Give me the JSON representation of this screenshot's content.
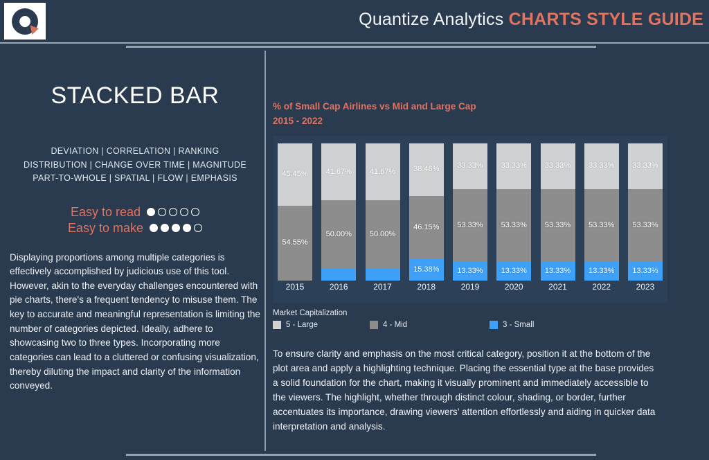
{
  "header": {
    "brand": "Quantize Analytics",
    "guide": "CHARTS STYLE GUIDE",
    "logo_icon": "donut-chart-logo-icon",
    "accent_color": "#e3725f",
    "background_color": "#2a3a4f"
  },
  "left": {
    "chart_type_title": "STACKED BAR",
    "taxonomy": [
      "DEVIATION | CORRELATION | RANKING",
      "DISTRIBUTION | CHANGE OVER TIME | MAGNITUDE",
      "PART-TO-WHOLE | SPATIAL | FLOW | EMPHASIS"
    ],
    "ratings": [
      {
        "label": "Easy to read",
        "filled": 1,
        "total": 5
      },
      {
        "label": "Easy to make",
        "filled": 4,
        "total": 5
      }
    ],
    "body": "Displaying proportions among multiple categories is effectively accomplished by judicious use of this tool. However, akin to the everyday challenges encountered with pie charts, there's a frequent tendency to misuse them. The key to accurate and meaningful representation is limiting the number of categories depicted. Ideally, adhere to showcasing two to three types. Incorporating more categories can lead to a cluttered or confusing visualization, thereby diluting the impact and clarity of the information conveyed."
  },
  "right": {
    "chart_title_line1": "% of Small Cap Airlines vs Mid and Large Cap",
    "chart_title_line2": "2015 - 2022",
    "body": "To ensure clarity and emphasis on the most critical category, position it at the bottom of the plot area and apply a highlighting technique. Placing the essential type at the base provides a solid foundation for the chart, making it visually prominent and immediately accessible to the viewers. The highlight, whether through distinct colour, shading, or border, further accentuates its importance, drawing viewers’ attention effortlessly and aiding in quicker data interpretation and analysis."
  },
  "chart_data": {
    "type": "bar",
    "stacked": true,
    "title": "% of Small Cap Airlines vs Mid and Large Cap 2015 - 2022",
    "xlabel": "",
    "ylabel": "",
    "ylim": [
      0,
      100
    ],
    "grid": false,
    "legend_title": "Market Capitalization",
    "legend_position": "bottom-left",
    "categories": [
      "2015",
      "2016",
      "2017",
      "2018",
      "2019",
      "2020",
      "2021",
      "2022",
      "2023"
    ],
    "series": [
      {
        "name": "5 - Large",
        "color": "#cfd1d2",
        "values": [
          45.45,
          41.67,
          41.67,
          38.46,
          33.33,
          33.33,
          33.33,
          33.33,
          33.33
        ],
        "labels": [
          "45.45%",
          "41.67%",
          "41.67%",
          "38.46%",
          "33.33%",
          "33.33%",
          "33.33%",
          "33.33%",
          "33.33%"
        ]
      },
      {
        "name": "4 - Mid",
        "color": "#8d8d8d",
        "values": [
          54.55,
          50.0,
          50.0,
          46.15,
          53.33,
          53.33,
          53.33,
          53.33,
          53.33
        ],
        "labels": [
          "54.55%",
          "50.00%",
          "50.00%",
          "46.15%",
          "53.33%",
          "53.33%",
          "53.33%",
          "53.33%",
          "53.33%"
        ]
      },
      {
        "name": "3 - Small",
        "color": "#3fa0f7",
        "values": [
          0.0,
          8.33,
          8.33,
          15.38,
          13.33,
          13.33,
          13.33,
          13.33,
          13.33
        ],
        "labels": [
          "",
          "",
          "",
          "15.38%",
          "13.33%",
          "13.33%",
          "13.33%",
          "13.33%",
          "13.33%"
        ]
      }
    ]
  }
}
